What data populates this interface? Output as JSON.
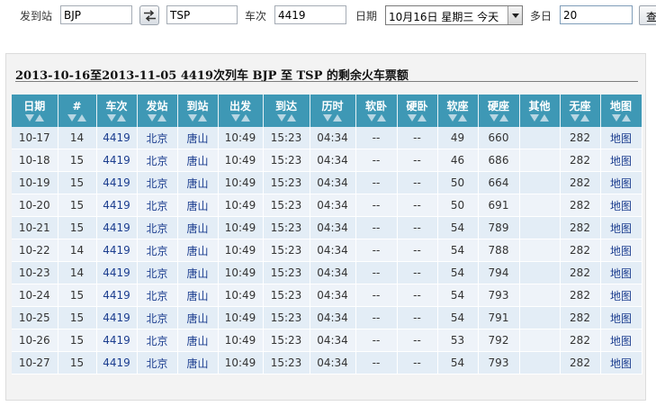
{
  "search": {
    "from_label": "发到站",
    "from_value": "BJP",
    "to_value": "TSP",
    "train_label": "车次",
    "train_value": "4419",
    "date_label": "日期",
    "date_value": "10月16日 星期三 今天",
    "days_label": "多日",
    "days_value": "20",
    "query_label": "查"
  },
  "result": {
    "title": "2013-10-16至2013-11-05 4419次列车 BJP 至 TSP 的剩余火车票额",
    "headers": [
      "日期",
      "#",
      "车次",
      "发站",
      "到站",
      "出发",
      "到达",
      "历时",
      "软卧",
      "硬卧",
      "软座",
      "硬座",
      "其他",
      "无座",
      "地图"
    ],
    "rows": [
      [
        "10-17",
        "14",
        "4419",
        "北京",
        "唐山",
        "10:49",
        "15:23",
        "04:34",
        "--",
        "--",
        "49",
        "660",
        "",
        "282",
        "地图"
      ],
      [
        "10-18",
        "15",
        "4419",
        "北京",
        "唐山",
        "10:49",
        "15:23",
        "04:34",
        "--",
        "--",
        "46",
        "686",
        "",
        "282",
        "地图"
      ],
      [
        "10-19",
        "15",
        "4419",
        "北京",
        "唐山",
        "10:49",
        "15:23",
        "04:34",
        "--",
        "--",
        "50",
        "664",
        "",
        "282",
        "地图"
      ],
      [
        "10-20",
        "15",
        "4419",
        "北京",
        "唐山",
        "10:49",
        "15:23",
        "04:34",
        "--",
        "--",
        "50",
        "691",
        "",
        "282",
        "地图"
      ],
      [
        "10-21",
        "15",
        "4419",
        "北京",
        "唐山",
        "10:49",
        "15:23",
        "04:34",
        "--",
        "--",
        "54",
        "789",
        "",
        "282",
        "地图"
      ],
      [
        "10-22",
        "14",
        "4419",
        "北京",
        "唐山",
        "10:49",
        "15:23",
        "04:34",
        "--",
        "--",
        "54",
        "788",
        "",
        "282",
        "地图"
      ],
      [
        "10-23",
        "14",
        "4419",
        "北京",
        "唐山",
        "10:49",
        "15:23",
        "04:34",
        "--",
        "--",
        "54",
        "794",
        "",
        "282",
        "地图"
      ],
      [
        "10-24",
        "15",
        "4419",
        "北京",
        "唐山",
        "10:49",
        "15:23",
        "04:34",
        "--",
        "--",
        "54",
        "793",
        "",
        "282",
        "地图"
      ],
      [
        "10-25",
        "15",
        "4419",
        "北京",
        "唐山",
        "10:49",
        "15:23",
        "04:34",
        "--",
        "--",
        "54",
        "791",
        "",
        "282",
        "地图"
      ],
      [
        "10-26",
        "15",
        "4419",
        "北京",
        "唐山",
        "10:49",
        "15:23",
        "04:34",
        "--",
        "--",
        "53",
        "792",
        "",
        "282",
        "地图"
      ],
      [
        "10-27",
        "15",
        "4419",
        "北京",
        "唐山",
        "10:49",
        "15:23",
        "04:34",
        "--",
        "--",
        "54",
        "793",
        "",
        "282",
        "地图"
      ]
    ]
  },
  "colors": {
    "header_bg": "#3e98b5",
    "row_bg": "#e3edf6",
    "row_alt_bg": "#eef3f9",
    "link": "#1b3d8f",
    "selection": "#3169c6"
  }
}
